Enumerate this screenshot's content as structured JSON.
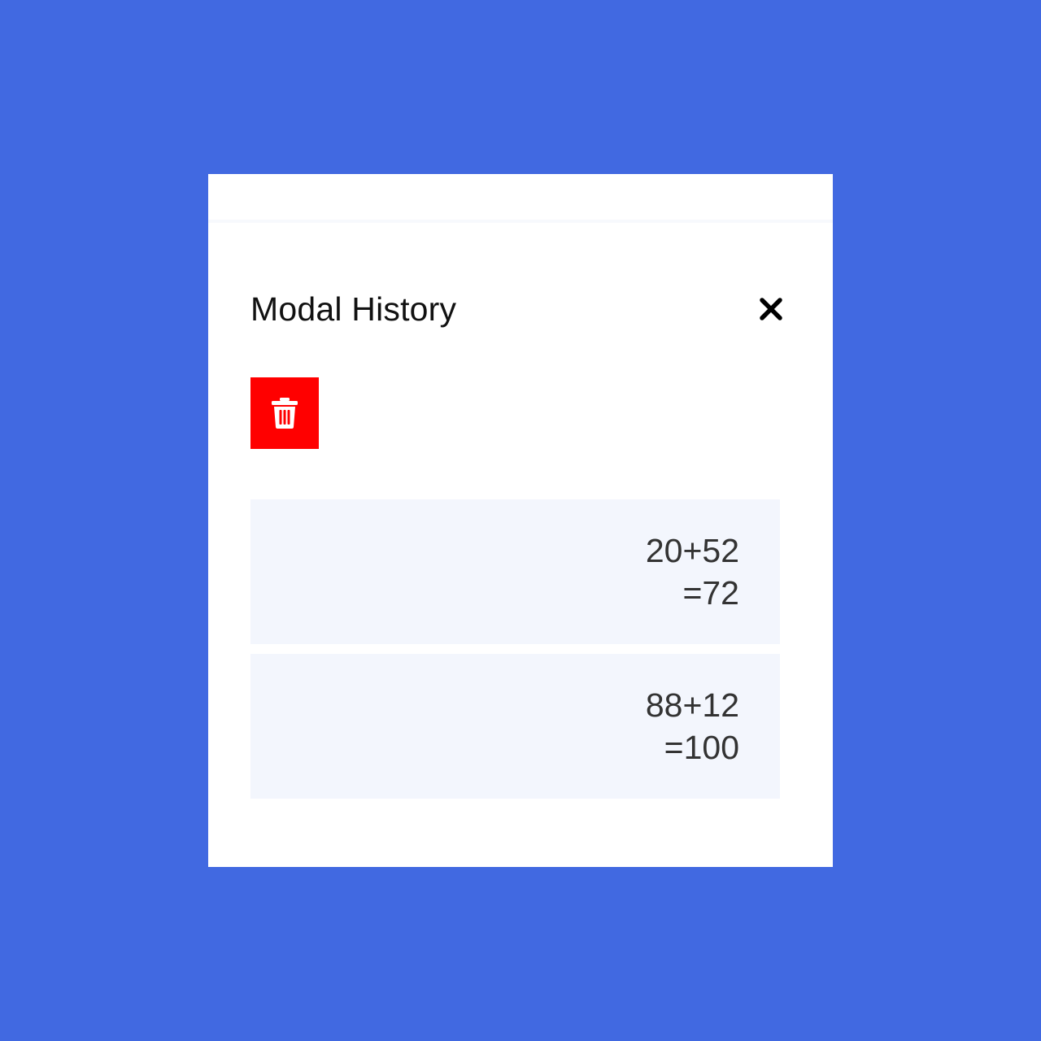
{
  "modal": {
    "title": "Modal History",
    "close_icon": "close-icon",
    "clear_icon": "trash-icon",
    "clear_button_color": "#ff0000",
    "background_color": "#4169e1"
  },
  "history": [
    {
      "expression": "20+52",
      "result": "=72"
    },
    {
      "expression": "88+12",
      "result": "=100"
    }
  ]
}
